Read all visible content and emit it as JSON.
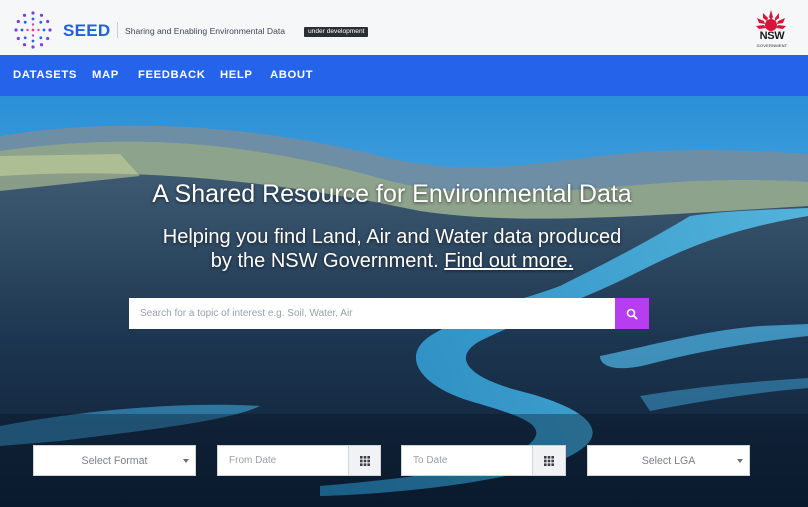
{
  "header": {
    "brand": "SEED",
    "tagline": "Sharing and Enabling Environmental Data",
    "badge": "under development",
    "nsw_logo_text": "NSW",
    "nsw_logo_sub": "GOVERNMENT"
  },
  "nav": {
    "items": [
      "DATASETS",
      "MAP",
      "FEEDBACK",
      "HELP",
      "ABOUT"
    ]
  },
  "hero": {
    "title": "A Shared Resource for Environmental Data",
    "subtitle_line1": "Helping you find Land, Air and Water data produced",
    "subtitle_line2": "by the NSW Government.",
    "link_text": "Find out more."
  },
  "search": {
    "placeholder": "Search for a topic of interest e.g. Soil, Water, Air",
    "button_icon": "search-icon",
    "button_color": "#b63df0"
  },
  "filters": {
    "format": "Select Format",
    "from_date_placeholder": "From Date",
    "to_date_placeholder": "To Date",
    "lga": "Select LGA",
    "calendar_icon": "calendar-grid-icon"
  },
  "colors": {
    "brand_blue": "#2563eb",
    "accent_purple": "#b63df0"
  }
}
